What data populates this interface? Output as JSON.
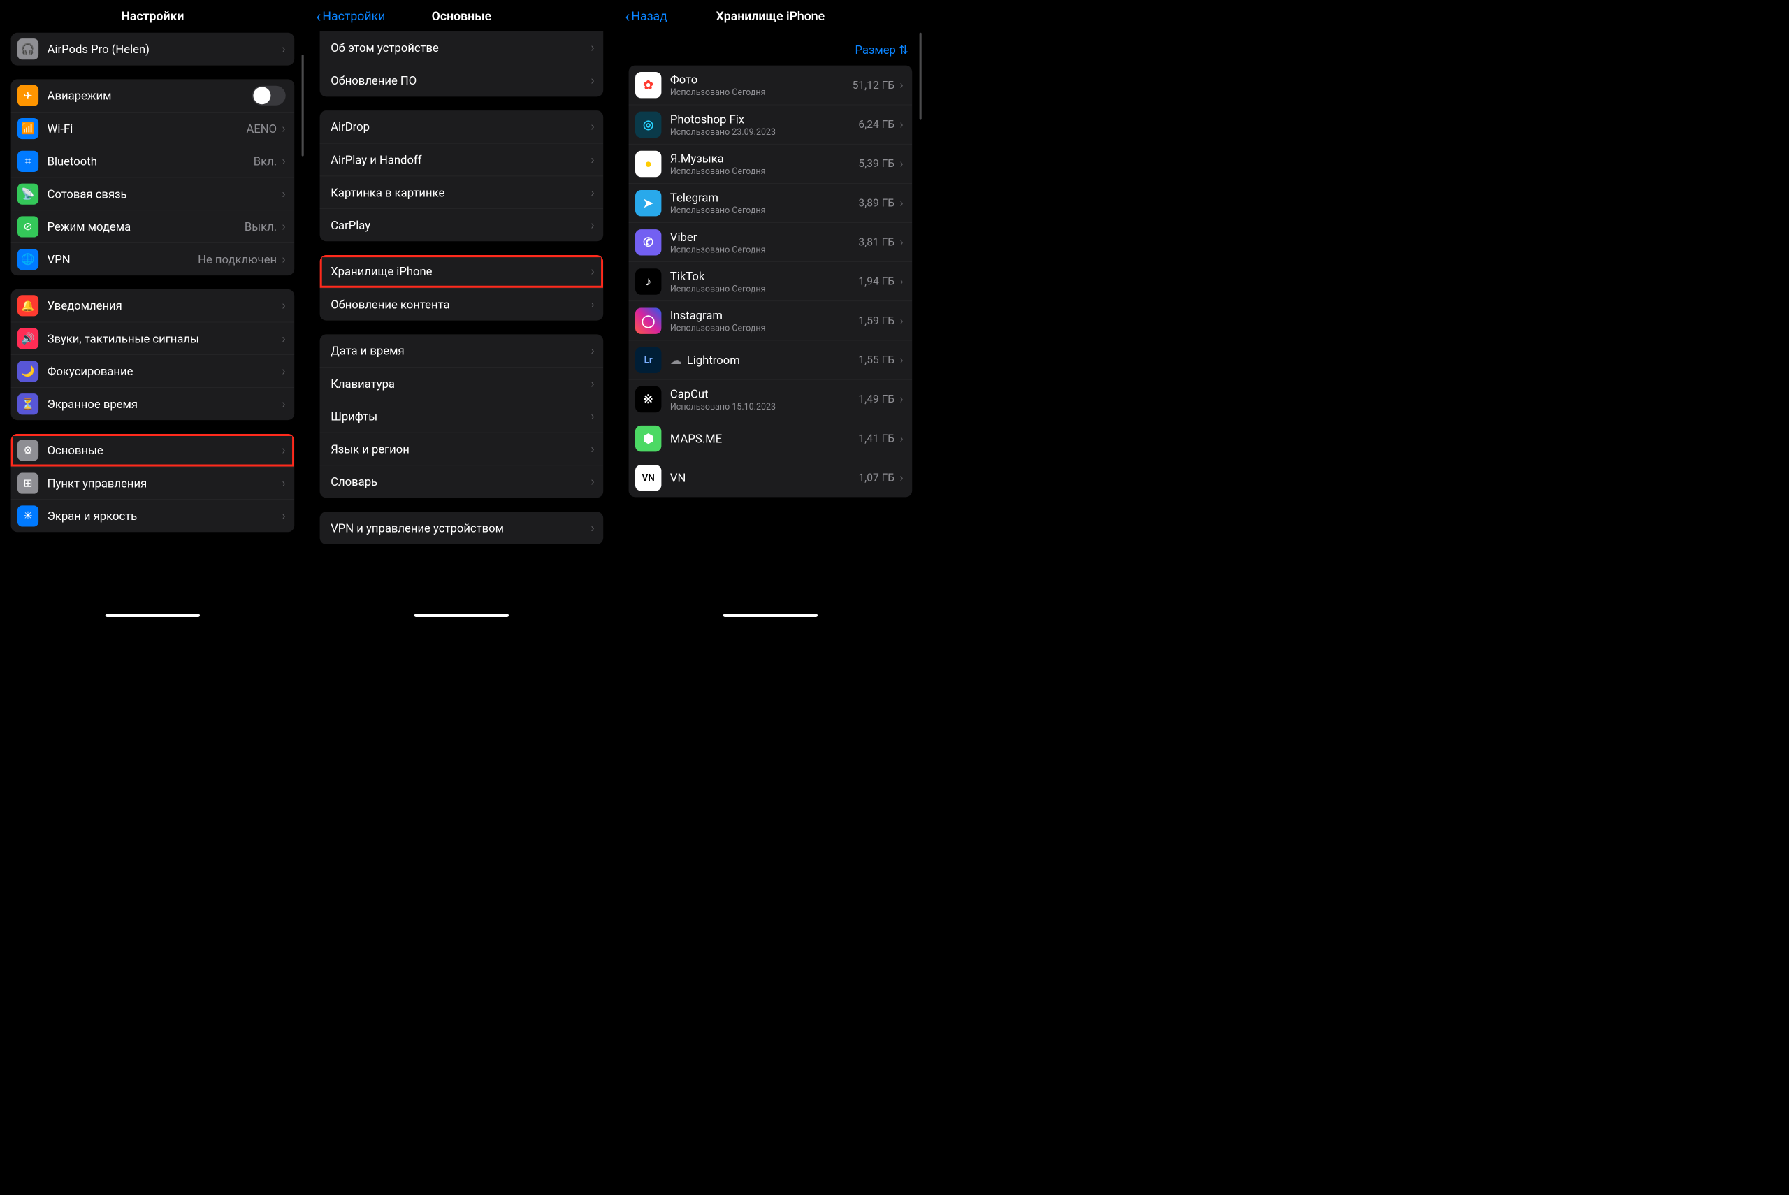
{
  "pane1": {
    "title": "Настройки",
    "airpods": {
      "label": "AirPods Pro (Helen)"
    },
    "conn": {
      "airplane": "Авиарежим",
      "wifi": "Wi-Fi",
      "wifi_value": "AENO",
      "bluetooth": "Bluetooth",
      "bluetooth_value": "Вкл.",
      "cellular": "Сотовая связь",
      "hotspot": "Режим модема",
      "hotspot_value": "Выкл.",
      "vpn": "VPN",
      "vpn_value": "Не подключен"
    },
    "notif": {
      "notifications": "Уведомления",
      "sounds": "Звуки, тактильные сигналы",
      "focus": "Фокусирование",
      "screentime": "Экранное время"
    },
    "sys": {
      "general": "Основные",
      "control": "Пункт управления",
      "display": "Экран и яркость"
    }
  },
  "pane2": {
    "back": "Настройки",
    "title": "Основные",
    "g1": {
      "about": "Об этом устройстве",
      "update": "Обновление ПО"
    },
    "g2": {
      "airdrop": "AirDrop",
      "airplay": "AirPlay и Handoff",
      "pip": "Картинка в картинке",
      "carplay": "CarPlay"
    },
    "g3": {
      "storage": "Хранилище iPhone",
      "bgrefresh": "Обновление контента"
    },
    "g4": {
      "date": "Дата и время",
      "keyboard": "Клавиатура",
      "fonts": "Шрифты",
      "lang": "Язык и регион",
      "dict": "Словарь"
    },
    "g5": {
      "vpndm": "VPN и управление устройством"
    }
  },
  "pane3": {
    "back": "Назад",
    "title": "Хранилище iPhone",
    "sort": "Размер",
    "apps": [
      {
        "name": "Фото",
        "sub": "Использовано Сегодня",
        "size": "51,12 ГБ",
        "bg": "#fff",
        "fg": "#ff3b30",
        "glyph": "✿"
      },
      {
        "name": "Photoshop Fix",
        "sub": "Использовано 23.09.2023",
        "size": "6,24 ГБ",
        "bg": "#0a3a4a",
        "fg": "#29d3ff",
        "glyph": "◎"
      },
      {
        "name": "Я.Музыка",
        "sub": "Использовано Сегодня",
        "size": "5,39 ГБ",
        "bg": "#fff",
        "fg": "#ffcc00",
        "glyph": "●"
      },
      {
        "name": "Telegram",
        "sub": "Использовано Сегодня",
        "size": "3,89 ГБ",
        "bg": "#29a9eb",
        "fg": "#fff",
        "glyph": "➤"
      },
      {
        "name": "Viber",
        "sub": "Использовано Сегодня",
        "size": "3,81 ГБ",
        "bg": "#7360f2",
        "fg": "#fff",
        "glyph": "✆"
      },
      {
        "name": "TikTok",
        "sub": "Использовано Сегодня",
        "size": "1,94 ГБ",
        "bg": "#000",
        "fg": "#fff",
        "glyph": "♪"
      },
      {
        "name": "Instagram",
        "sub": "Использовано Сегодня",
        "size": "1,59 ГБ",
        "bg": "linear-gradient(45deg,#fd5949,#d6249f,#285AEB)",
        "fg": "#fff",
        "glyph": "◯"
      },
      {
        "name": "Lightroom",
        "sub": "",
        "size": "1,55 ГБ",
        "bg": "#001e36",
        "fg": "#7bafff",
        "glyph": "Lr",
        "cloud": true
      },
      {
        "name": "CapCut",
        "sub": "Использовано 15.10.2023",
        "size": "1,49 ГБ",
        "bg": "#000",
        "fg": "#fff",
        "glyph": "※"
      },
      {
        "name": "MAPS.ME",
        "sub": "",
        "size": "1,41 ГБ",
        "bg": "#4cd964",
        "fg": "#fff",
        "glyph": "⬢"
      },
      {
        "name": "VN",
        "sub": "",
        "size": "1,07 ГБ",
        "bg": "#fff",
        "fg": "#000",
        "glyph": "VN"
      }
    ]
  }
}
